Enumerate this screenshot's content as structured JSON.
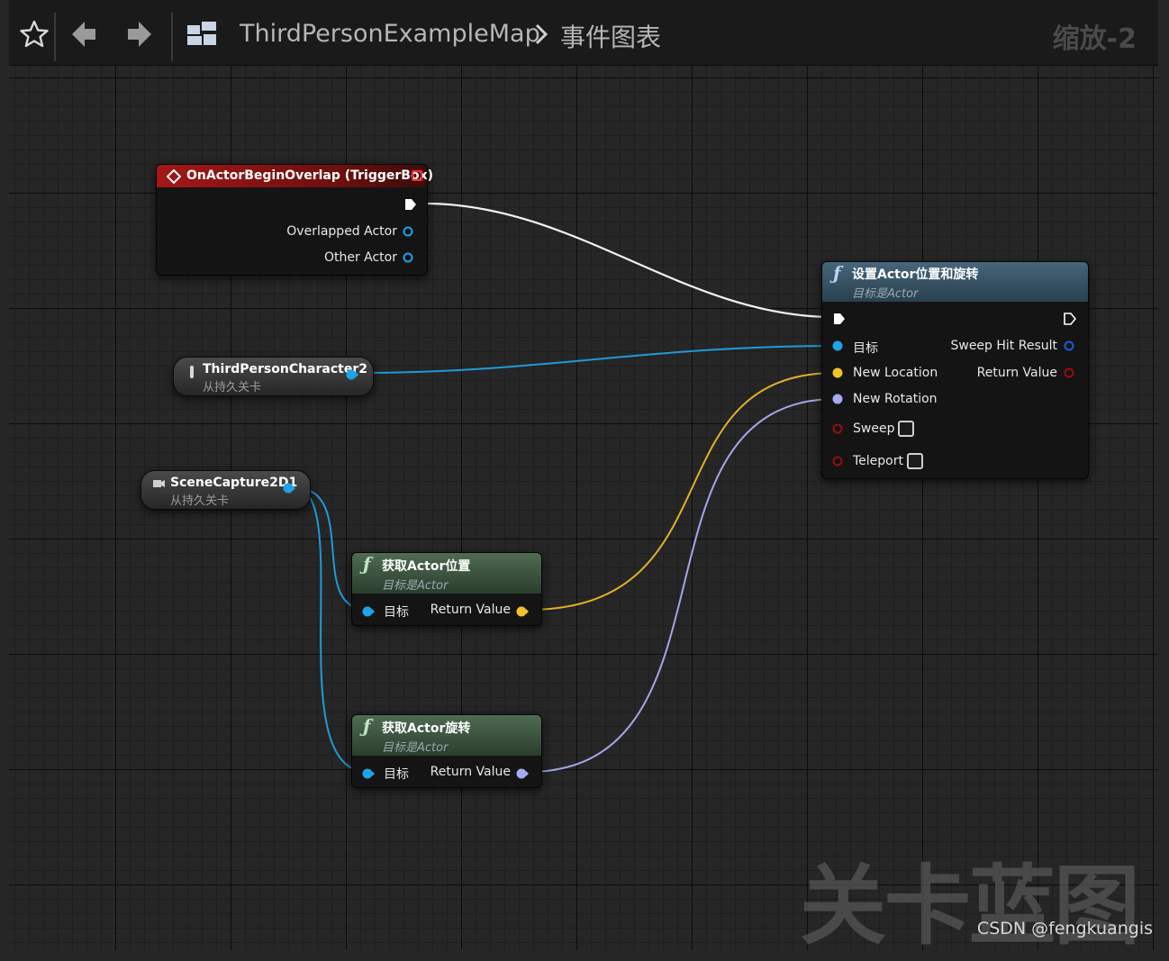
{
  "toolbar": {
    "breadcrumb_map": "ThirdPersonExampleMap",
    "breadcrumb_graph": "事件图表",
    "zoom": "缩放-2"
  },
  "nodes": {
    "overlap_event": {
      "title": "OnActorBeginOverlap (TriggerBox)",
      "pins": [
        "Overlapped Actor",
        "Other Actor"
      ]
    },
    "third_person_ref": {
      "title": "ThirdPersonCharacter2",
      "subtitle": "从持久关卡"
    },
    "scene_capture_ref": {
      "title": "SceneCapture2D1",
      "subtitle": "从持久关卡"
    },
    "set_location_rotation": {
      "title": "设置Actor位置和旋转",
      "subtitle": "目标是Actor",
      "inputs": [
        "目标",
        "New Location",
        "New Rotation",
        "Sweep",
        "Teleport"
      ],
      "outputs": [
        "Sweep Hit Result",
        "Return Value"
      ]
    },
    "get_location": {
      "title": "获取Actor位置",
      "subtitle": "目标是Actor",
      "input": "目标",
      "output": "Return Value"
    },
    "get_rotation": {
      "title": "获取Actor旋转",
      "subtitle": "目标是Actor",
      "input": "目标",
      "output": "Return Value"
    }
  },
  "colors": {
    "exec": "#ffffff",
    "object": "#1ea3e8",
    "vector": "#f2c22a",
    "rotator": "#a6aaf2",
    "bool": "#8b0a0a",
    "event_header": "#8a1212",
    "function_header": "#2e4b5f",
    "pure_header": "#2e4a32"
  },
  "watermark": {
    "text": "关卡蓝图"
  },
  "credit": {
    "text": "CSDN @fengkuangis"
  }
}
